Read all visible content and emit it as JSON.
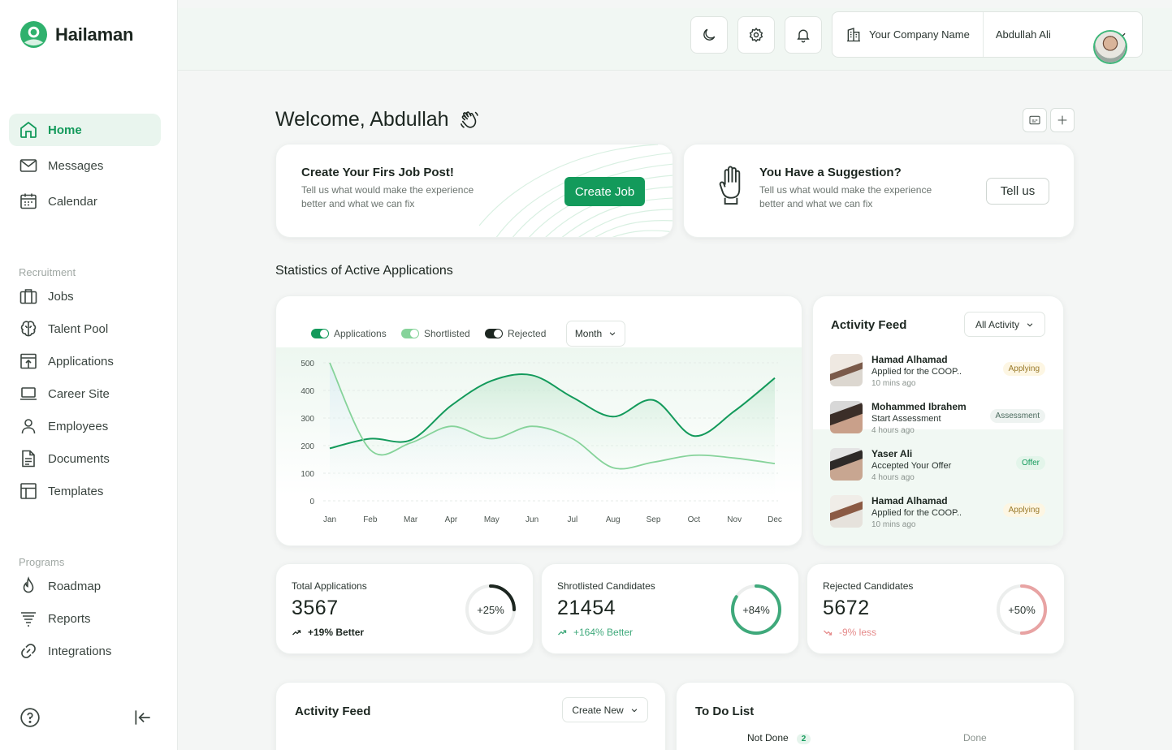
{
  "app": {
    "name": "Hailaman"
  },
  "sidebar": {
    "main_items": [
      {
        "label": "Home",
        "icon": "home-icon"
      },
      {
        "label": "Messages",
        "icon": "mail-icon"
      },
      {
        "label": "Calendar",
        "icon": "calendar-icon"
      }
    ],
    "recruitment_title": "Recruitment",
    "recruitment_items": [
      {
        "label": "Jobs",
        "icon": "briefcase-icon"
      },
      {
        "label": "Talent Pool",
        "icon": "brain-icon"
      },
      {
        "label": "Applications",
        "icon": "inbox-upload-icon"
      },
      {
        "label": "Career Site",
        "icon": "laptop-icon"
      },
      {
        "label": "Employees",
        "icon": "user-icon"
      },
      {
        "label": "Documents",
        "icon": "document-icon"
      },
      {
        "label": "Templates",
        "icon": "layout-icon"
      }
    ],
    "programs_title": "Programs",
    "programs_items": [
      {
        "label": "Roadmap",
        "icon": "flame-icon"
      },
      {
        "label": "Reports",
        "icon": "filter-lines-icon"
      },
      {
        "label": "Integrations",
        "icon": "link-icon"
      }
    ]
  },
  "topbar": {
    "company": "Your Company Name",
    "user_name": "Abdullah Ali"
  },
  "welcome": {
    "text": "Welcome, Abdullah"
  },
  "job_card": {
    "title": "Create Your Firs Job Post!",
    "subtitle_line1": "Tell us what would make the experience",
    "subtitle_line2": "better and what we can fix",
    "button": "Create Job"
  },
  "suggestion_card": {
    "title": "You Have a Suggestion?",
    "subtitle_line1": "Tell us what would make the experience",
    "subtitle_line2": "better and what we can fix",
    "button": "Tell us"
  },
  "stats_section": {
    "title": "Statistics of Active Applications"
  },
  "chart_controls": {
    "legend": [
      "Applications",
      "Shortlisted",
      "Rejected"
    ],
    "period": "Month"
  },
  "chart_data": {
    "type": "area",
    "categories": [
      "Jan",
      "Feb",
      "Mar",
      "Apr",
      "May",
      "Jun",
      "Jul",
      "Aug",
      "Sep",
      "Oct",
      "Nov",
      "Dec"
    ],
    "ylim": [
      0,
      500
    ],
    "yticks": [
      0,
      100,
      200,
      300,
      400,
      500
    ],
    "grid": true,
    "series": [
      {
        "name": "Applications",
        "color": "#139a5b",
        "values": [
          190,
          225,
          220,
          345,
          435,
          455,
          375,
          305,
          365,
          235,
          325,
          445
        ]
      },
      {
        "name": "Shortlisted",
        "color": "#86d39a",
        "values": [
          500,
          185,
          210,
          270,
          225,
          270,
          225,
          120,
          140,
          165,
          155,
          135
        ]
      }
    ]
  },
  "activity_feed": {
    "title": "Activity Feed",
    "filter": "All Activity",
    "items": [
      {
        "name": "Hamad Alhamad",
        "action": "Applied for the COOP..",
        "time": "10 mins ago",
        "badge": "Applying"
      },
      {
        "name": "Mohammed Ibrahem",
        "action": "Start Assessment",
        "time": "4 hours ago",
        "badge": "Assessment"
      },
      {
        "name": "Yaser Ali",
        "action": "Accepted Your Offer",
        "time": "4 hours ago",
        "badge": "Offer"
      },
      {
        "name": "Hamad Alhamad",
        "action": "Applied for the COOP..",
        "time": "10 mins ago",
        "badge": "Applying"
      }
    ]
  },
  "stats": [
    {
      "label": "Total Applications",
      "value": "3567",
      "change": "+19% Better",
      "ring_text": "+25%",
      "ring_fraction": 0.25,
      "color": "#1c2620"
    },
    {
      "label": "Shrotlisted Candidates",
      "value": "21454",
      "change": "+164% Better",
      "ring_text": "+84%",
      "ring_fraction": 0.84,
      "color": "#3fa97b"
    },
    {
      "label": "Rejected Candidates",
      "value": "5672",
      "change": "-9% less",
      "ring_text": "+50%",
      "ring_fraction": 0.5,
      "color": "#e8a3a3"
    }
  ],
  "bottom_activity": {
    "title": "Activity Feed",
    "button": "Create New"
  },
  "todo": {
    "title": "To Do List",
    "tab_not_done": "Not Done",
    "not_done_count": "2",
    "tab_done": "Done"
  }
}
